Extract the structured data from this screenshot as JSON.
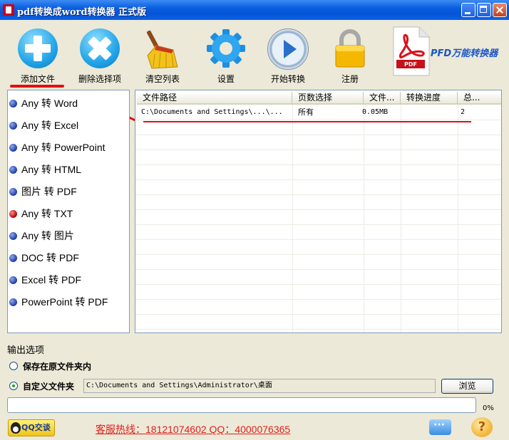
{
  "window": {
    "title": "pdf转换成word转换器  正式版"
  },
  "toolbar": {
    "add_file": "添加文件",
    "remove_selected": "删除选择项",
    "clear_list": "清空列表",
    "settings": "设置",
    "start_convert": "开始转换",
    "register": "注册",
    "brand": "PFD万能转换器"
  },
  "icons": {
    "add": "add-file-icon",
    "remove": "remove-icon",
    "clear": "broom-icon",
    "settings": "gear-icon",
    "start": "play-icon",
    "register": "lock-icon",
    "logo": "pdf-logo-icon",
    "logo_text": "PDF"
  },
  "conversion_types": [
    {
      "label": "Any 转 Word",
      "selected": false
    },
    {
      "label": "Any 转 Excel",
      "selected": false
    },
    {
      "label": "Any 转 PowerPoint",
      "selected": false
    },
    {
      "label": "Any 转 HTML",
      "selected": false
    },
    {
      "label": "图片 转 PDF",
      "selected": false
    },
    {
      "label": "Any 转 TXT",
      "selected": true
    },
    {
      "label": "Any 转 图片",
      "selected": false
    },
    {
      "label": "DOC 转 PDF",
      "selected": false
    },
    {
      "label": "Excel 转 PDF",
      "selected": false
    },
    {
      "label": "PowerPoint 转 PDF",
      "selected": false
    }
  ],
  "file_table": {
    "columns": [
      "文件路径",
      "页数选择",
      "文件...",
      "转换进度",
      "总..."
    ],
    "rows": [
      {
        "path": "C:\\Documents and Settings\\...\\...",
        "pages": "所有",
        "size": "0.05MB",
        "progress": "",
        "total": "2"
      }
    ]
  },
  "output": {
    "title": "输出选项",
    "option_original": "保存在原文件夹内",
    "option_custom": "自定义文件夹",
    "selected": "custom",
    "custom_path": "C:\\Documents and Settings\\Administrator\\桌面",
    "browse": "浏览"
  },
  "progress": {
    "value": 0,
    "label": "0%"
  },
  "footer": {
    "qq": "QQ交谈",
    "hotline": "客服热线：18121074602 QQ：4000076365"
  },
  "colors": {
    "title_bar": "#0a5ee0",
    "annotation": "#e01010",
    "hotline": "#e0201a",
    "selected_bullet": "#b00000"
  }
}
